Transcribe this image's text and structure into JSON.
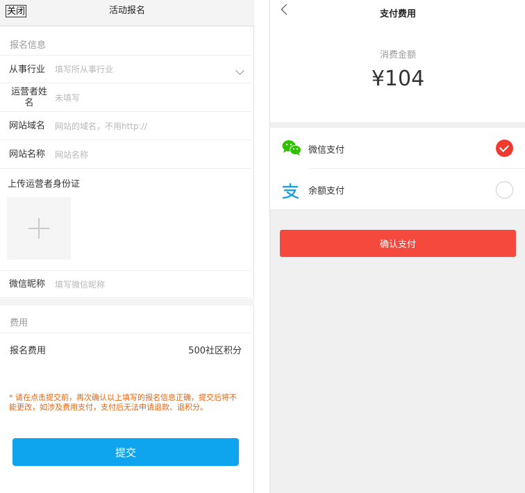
{
  "left": {
    "close_label": "关闭",
    "title": "活动报名",
    "info_section": "报名信息",
    "fields": [
      {
        "label": "从事行业",
        "placeholder": "填写所从事行业"
      },
      {
        "label": "运营者姓名",
        "placeholder": "未填写"
      },
      {
        "label": "网站域名",
        "placeholder": "网站的域名，不用http://"
      },
      {
        "label": "网站名称",
        "placeholder": "网站名称"
      }
    ],
    "upload_label": "上传运营者身份证",
    "wechat_field": {
      "label": "微信昵称",
      "placeholder": "填写微信昵称"
    },
    "fee_section": "费用",
    "fee": {
      "label": "报名费用",
      "value": "500社区积分"
    },
    "notice": "* 请在点击提交前，再次确认以上填写的报名信息正确，提交后将不能更改，如涉及费用支付，支付后无法申请退款、退积分。",
    "submit_label": "提交"
  },
  "right": {
    "title": "支付费用",
    "amount_label": "消费金额",
    "amount": "¥104",
    "methods": [
      {
        "label": "微信支付",
        "icon": "wechat-icon",
        "selected": true
      },
      {
        "label": "余额支付",
        "icon": "alipay-icon",
        "selected": false
      }
    ],
    "confirm_label": "确认支付"
  },
  "colors": {
    "submit": "#0ea4ee",
    "confirm": "#f6493d",
    "check": "#f03a2e",
    "notice": "#e8620d",
    "wechat": "#2dc100",
    "alipay": "#1e9fe2"
  }
}
